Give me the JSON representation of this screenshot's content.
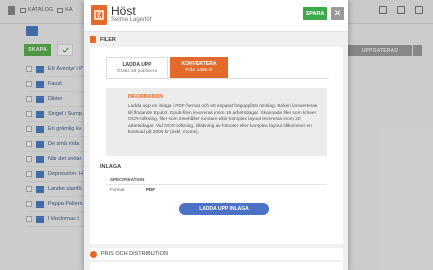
{
  "topbar": {
    "tabs": [
      "KATALOG",
      "KA"
    ]
  },
  "bg": {
    "create_label": "SKAPA",
    "published_label": "UPPDATERAD",
    "list": [
      "Ett Äventyr i P",
      "Faust",
      "Dikter",
      "Singel i Sump",
      "En grämlig kv",
      "De små röda",
      "När det snöar",
      "Depression: H",
      "Landet utanfö",
      "Pappa Pellern",
      "I kloclornas t"
    ]
  },
  "modal": {
    "title": "Höst",
    "author": "Selma Lagerlöf",
    "save_label": "SPARA",
    "close_label": "✕",
    "files_label": "FILER",
    "tabs": {
      "upload_title": "LADDA UPP",
      "upload_sub": "Gratis att publicera",
      "convert_title": "KONVERTERA",
      "convert_sub": "Från 1495 kr"
    },
    "info": {
      "heading": "INFORMATION",
      "text": "Ladda upp en inlaga i PDF-format och ett separat högupplöst omslag. Boken konverteras till flödande Epub3. Epub-filen levereras inom 15 arbetsdagar. Skannade filer som kräver OCR-tolkning, filer som innehåller tunnare eller komplex layout levereras inom 20 arbetsdagar. Vid OCR-tolkning, tilläkning av fotnoter eller komplex layout tillkommer en kostnad på 2000 kr (exkl. moms)."
    },
    "output": {
      "heading": "INLAGA",
      "spec_header": "SPECIFIKATION",
      "format_key": "Format",
      "format_value": "PDF",
      "upload_button": "LADDA UPP INLAGA"
    },
    "price_label": "PRIS OCH DISTRIBUTION"
  },
  "colors": {
    "accent": "#e26b2c",
    "save": "#3ba84a",
    "button_blue": "#4c72c6"
  }
}
